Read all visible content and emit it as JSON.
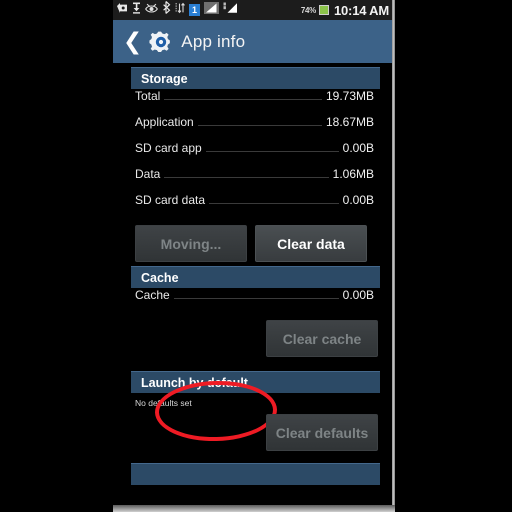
{
  "statusbar": {
    "icons": [
      {
        "name": "download-arrow-icon",
        "label": "download"
      },
      {
        "name": "usb-connection-icon",
        "label": "usb"
      },
      {
        "name": "smart-stay-eye-icon",
        "label": "smart stay"
      },
      {
        "name": "bluetooth-icon",
        "label": "bluetooth"
      },
      {
        "name": "data-transfer-icon",
        "label": "data transfer"
      }
    ],
    "sim_badge": "1",
    "signal_bars_1": "signal-bars-icon",
    "signal_bars_2": "signal-bars-icon",
    "battery_percent": "74%",
    "battery_icon": "battery-icon",
    "clock": "10:14 AM"
  },
  "actionbar": {
    "back_icon": "back-chevron-icon",
    "app_icon": "settings-gear-icon",
    "title": "App info"
  },
  "sections": {
    "storage": {
      "header": "Storage",
      "rows": [
        {
          "label": "Total",
          "value": "19.73MB"
        },
        {
          "label": "Application",
          "value": "18.67MB"
        },
        {
          "label": "SD card app",
          "value": "0.00B"
        },
        {
          "label": "Data",
          "value": "1.06MB"
        },
        {
          "label": "SD card data",
          "value": "0.00B"
        }
      ],
      "move_button": {
        "label": "Moving...",
        "enabled": false
      },
      "clear_data_button": {
        "label": "Clear data",
        "enabled": true
      }
    },
    "cache": {
      "header": "Cache",
      "rows": [
        {
          "label": "Cache",
          "value": "0.00B"
        }
      ],
      "clear_cache_button": {
        "label": "Clear cache",
        "enabled": false
      }
    },
    "launch_by_default": {
      "header": "Launch by default",
      "note": "No defaults set",
      "clear_defaults_button": {
        "label": "Clear defaults",
        "enabled": false
      }
    }
  },
  "annotation": {
    "name": "red-ellipse-highlight",
    "color": "#ee1b24",
    "targets": "Moving... button"
  },
  "colors": {
    "actionbar": "#3c6288",
    "section_header": "#2c4a66",
    "background": "#000000",
    "battery_green": "#8bc34a",
    "accent_red": "#ee1b24"
  }
}
